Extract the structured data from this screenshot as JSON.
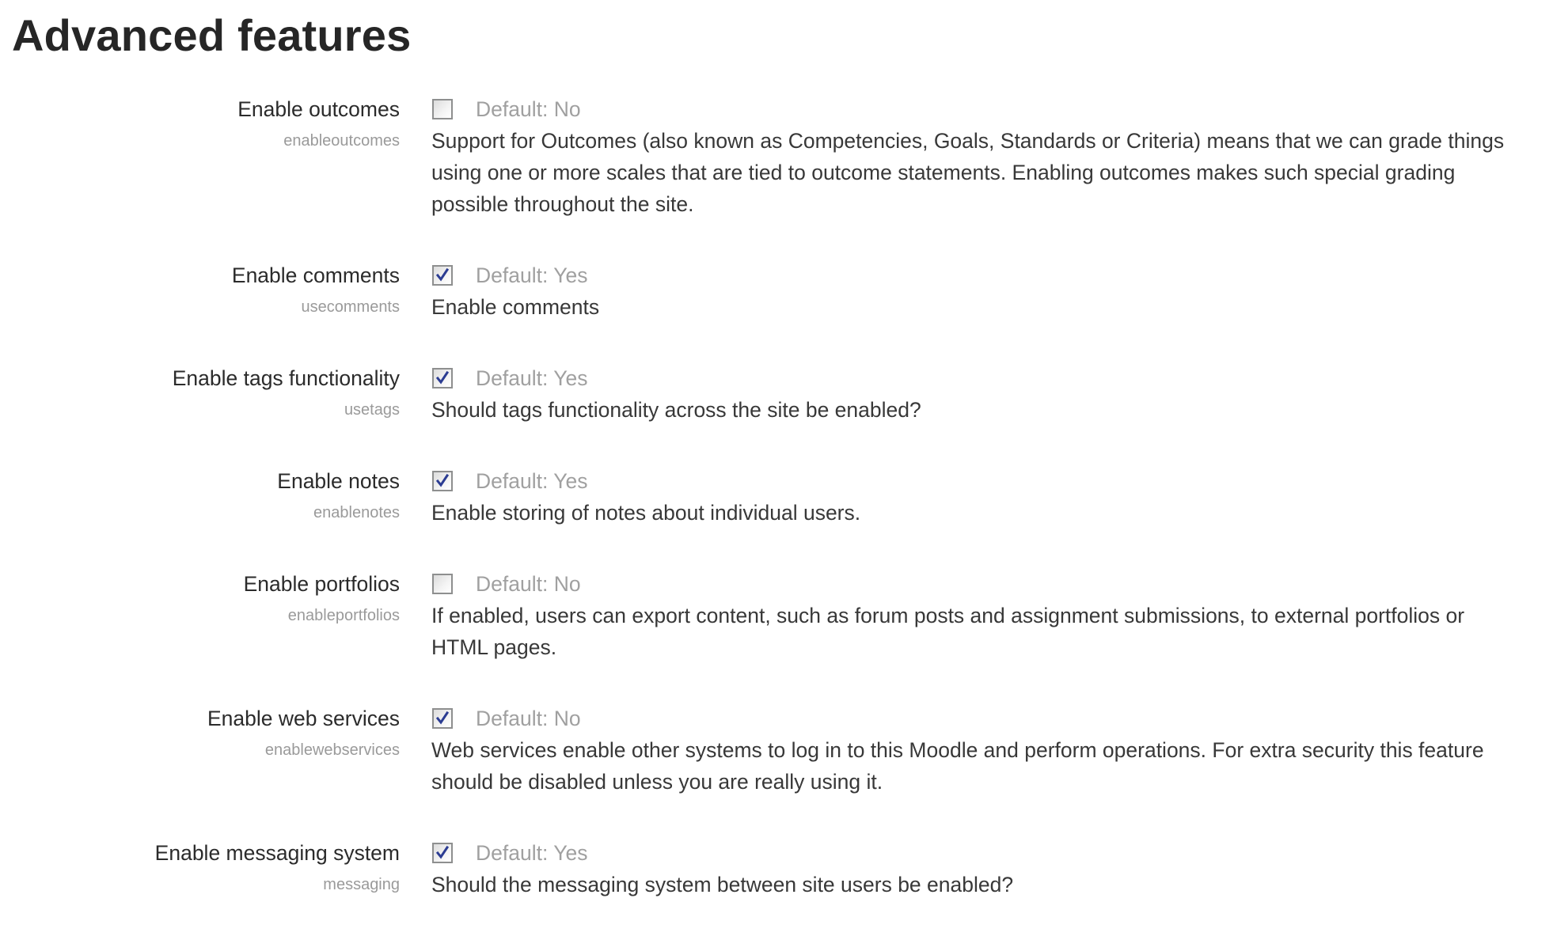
{
  "page": {
    "title": "Advanced features"
  },
  "settings": [
    {
      "label": "Enable outcomes",
      "key": "enableoutcomes",
      "checked": false,
      "default_text": "Default: No",
      "description": "Support for Outcomes (also known as Competencies, Goals, Standards or Criteria) means that we can grade things using one or more scales that are tied to outcome statements. Enabling outcomes makes such special grading possible throughout the site."
    },
    {
      "label": "Enable comments",
      "key": "usecomments",
      "checked": true,
      "default_text": "Default: Yes",
      "description": "Enable comments"
    },
    {
      "label": "Enable tags functionality",
      "key": "usetags",
      "checked": true,
      "default_text": "Default: Yes",
      "description": "Should tags functionality across the site be enabled?"
    },
    {
      "label": "Enable notes",
      "key": "enablenotes",
      "checked": true,
      "default_text": "Default: Yes",
      "description": "Enable storing of notes about individual users."
    },
    {
      "label": "Enable portfolios",
      "key": "enableportfolios",
      "checked": false,
      "default_text": "Default: No",
      "description": "If enabled, users can export content, such as forum posts and assignment submissions, to external portfolios or HTML pages."
    },
    {
      "label": "Enable web services",
      "key": "enablewebservices",
      "checked": true,
      "default_text": "Default: No",
      "description": "Web services enable other systems to log in to this Moodle and perform operations. For extra security this feature should be disabled unless you are really using it."
    },
    {
      "label": "Enable messaging system",
      "key": "messaging",
      "checked": true,
      "default_text": "Default: Yes",
      "description": "Should the messaging system between site users be enabled?"
    }
  ],
  "colors": {
    "check_mark": "#2b3c92",
    "checkbox_border": "#8e8f8f",
    "default_text": "#a0a0a0",
    "key_text": "#9a9a9a"
  }
}
